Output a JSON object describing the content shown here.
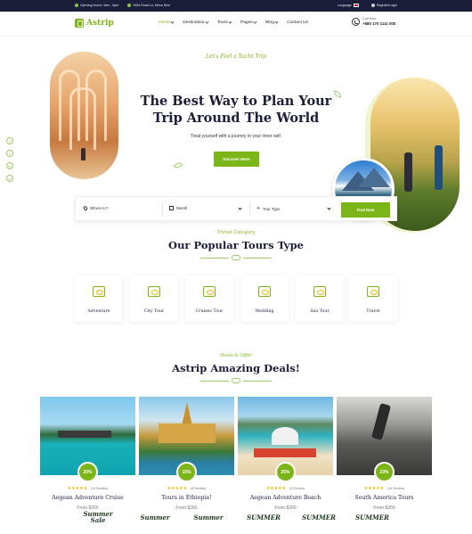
{
  "topbar": {
    "hours": "Opening Hours: 9am - 6pm",
    "address": "2454 Road Ln, Mesa New",
    "language": "Language",
    "auth": "Register/Login"
  },
  "header": {
    "logo": "Astrip",
    "nav": [
      {
        "label": "Home",
        "dropdown": true,
        "active": true
      },
      {
        "label": "Destination",
        "dropdown": true
      },
      {
        "label": "Tours",
        "dropdown": true
      },
      {
        "label": "Pages",
        "dropdown": true
      },
      {
        "label": "Blog",
        "dropdown": true
      },
      {
        "label": "Contact Us",
        "dropdown": false
      }
    ],
    "call_label": "Call Now",
    "call_number": "+880 170 1111 000"
  },
  "hero": {
    "subtitle": "Let's Feel a Yacht Trip",
    "title": "The Best Way to Plan Your Trip Around The World",
    "description": "Treat yourself with a journey to your inner self.",
    "cta": "Discover More",
    "social": [
      "f",
      "t",
      "in",
      "p"
    ]
  },
  "search": {
    "where_placeholder": "Where to?",
    "month": "Month",
    "tour_type": "Tour Type",
    "button": "Find Now"
  },
  "categories": {
    "script": "Travel Category",
    "title": "Our Popular Tours Type",
    "items": [
      "Adventure",
      "City Tour",
      "Cruises Tour",
      "Wedding",
      "Sea Tour",
      "Travel"
    ]
  },
  "deals": {
    "script": "Deals & Offer",
    "title": "Astrip Amazing Deals!",
    "items": [
      {
        "discount": "20%",
        "reviews": "(10 Review)",
        "title": "Aegean Adventure Cruise",
        "price": "From $260"
      },
      {
        "discount": "15%",
        "reviews": "(8 Review)",
        "title": "Tours in Ethiopia!",
        "price": "From $260"
      },
      {
        "discount": "25%",
        "reviews": "(9 Review)",
        "title": "Aegean Adventure Beach",
        "price": "From $260"
      },
      {
        "discount": "23%",
        "reviews": "(10 Review)",
        "title": "South America Tours",
        "price": "From $260"
      }
    ],
    "stars": "★★★★★"
  },
  "stickers": [
    "Summer Sale",
    "Summer",
    "Summer",
    "SUMMER",
    "SUMMER",
    "SUMMER"
  ],
  "colors": {
    "accent": "#7cb518",
    "dark": "#1b1e3b",
    "topbar": "#1b1e3b"
  }
}
